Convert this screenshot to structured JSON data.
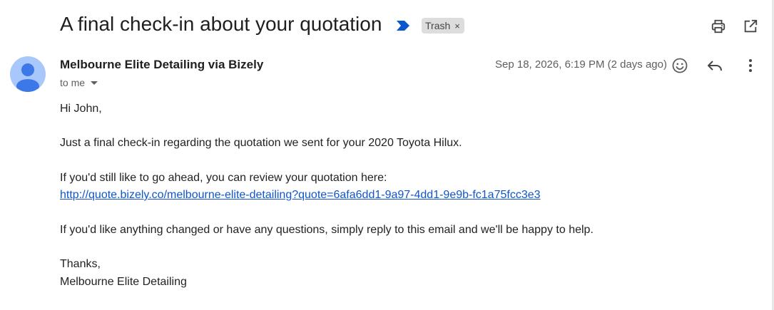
{
  "header": {
    "subject": "A final check-in about your quotation",
    "label": "Trash",
    "label_remove": "×",
    "icons": {
      "importance": "importance-marker-icon",
      "print": "print-icon",
      "new_window": "open-in-new-window-icon"
    }
  },
  "message": {
    "sender": "Melbourne Elite Detailing via Bizely",
    "recipient": "to me",
    "date": "Sep 18, 2026, 6:19 PM (2 days ago)",
    "actions": {
      "emoji": "emoji-reaction-icon",
      "reply": "reply-icon",
      "more": "more-vert-icon"
    }
  },
  "body": {
    "greeting": "Hi John,",
    "para1": "Just a final check-in regarding the quotation we sent for your 2020 Toyota Hilux.",
    "para2": "If you'd still like to go ahead, you can review your quotation here:",
    "link": "http://quote.bizely.co/melbourne-elite-detailing?quote=6afa6dd1-9a97-4dd1-9e9b-fc1a75fcc3e3",
    "para3": "If you'd like anything changed or have any questions, simply reply to this email and we'll be happy to help.",
    "signoff": "Thanks,",
    "signature": "Melbourne Elite Detailing"
  },
  "colors": {
    "accent_importance": "#0b57d0",
    "link": "#1155cc",
    "avatar_bg": "#a8c7fa",
    "avatar_fg": "#3c78e8",
    "chip_bg": "#dddddd"
  }
}
